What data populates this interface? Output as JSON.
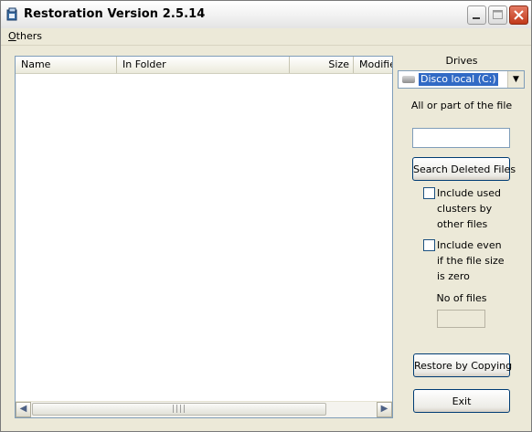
{
  "window": {
    "title": "Restoration Version 2.5.14",
    "icon": "restoration-app-icon",
    "controls": [
      "minimize-icon",
      "maximize-icon",
      "close-icon"
    ]
  },
  "menu": {
    "items": [
      {
        "label": "Others"
      }
    ]
  },
  "file_list": {
    "columns": [
      {
        "label": "Name"
      },
      {
        "label": "In Folder"
      },
      {
        "label": "Size"
      },
      {
        "label": "Modified"
      }
    ],
    "rows": [],
    "scrollbar_grip": "||||"
  },
  "drives": {
    "label": "Drives",
    "selected": "Disco local (C:)",
    "icon": "hard-drive-icon"
  },
  "search": {
    "label": "All or part of the file",
    "value": "",
    "button_label": "Search Deleted Files"
  },
  "options": {
    "include_used_clusters": {
      "label": "Include used clusters by other files",
      "checked": false
    },
    "include_zero_size": {
      "label": "Include even if the file size is zero",
      "checked": false
    }
  },
  "count": {
    "label": "No of files",
    "value": ""
  },
  "actions": {
    "restore_label": "Restore by Copying",
    "exit_label": "Exit"
  }
}
